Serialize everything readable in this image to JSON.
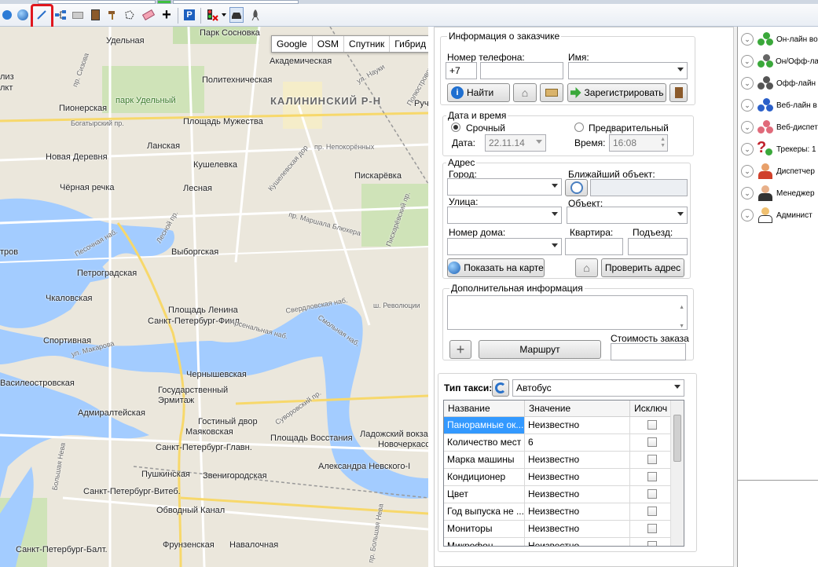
{
  "map": {
    "type_buttons": [
      "Google",
      "OSM",
      "Спутник",
      "Гибрид"
    ],
    "labels": [
      "Парк Сосновка",
      "Удельная",
      "Академическая",
      "Политехническая",
      "Пионерская",
      "парк Удельный",
      "КАЛИНИНСКИЙ Р-Н",
      "Площадь Мужества",
      "Новая Деревня",
      "Ланская",
      "Кушелевка",
      "Пискарёвка",
      "Чёрная речка",
      "Лесная",
      "Выборгская",
      "Петроградская",
      "Чкаловская",
      "Площадь Ленина",
      "Санкт-Петербург-Финл.",
      "Спортивная",
      "Чернышевская",
      "Государственный Эрмитаж",
      "Адмиралтейская",
      "Гостиный двор",
      "Маяковская",
      "Площадь Восстания",
      "Санкт-Петербург-Главн.",
      "Ладожский вокзал",
      "Новочеркасская",
      "Пушкинская",
      "Звенигородская",
      "Александра Невского-I",
      "Санкт-Петербург-Витеб.",
      "Обводный Канал",
      "Санкт-Петербург-Балт.",
      "Фрунзенская",
      "Навалочная",
      "Василеостровская",
      "тров",
      "лиз",
      "лкт",
      "Руч"
    ],
    "streets": [
      "пр. Сизова",
      "Богатырский пр.",
      "ул. Науки",
      "пр. Непокорённых",
      "Кушелевская дор",
      "пр. Маршала Блюхера",
      "Лесной пр.",
      "Пискарёвский пр.",
      "Песочная наб.",
      "Свердловская наб.",
      "ш. Революции",
      "Арсенальная наб.",
      "Смольная наб.",
      "ул. Макарова",
      "Суворовский пр.",
      "Большая Нева",
      "Полюстровский пр.",
      "пр. Большая Нева"
    ]
  },
  "order": {
    "customer": {
      "title": "Информация о заказчике",
      "phone_label": "Номер телефона:",
      "phone_value": "+7",
      "name_label": "Имя:",
      "find_button": "Найти",
      "register_button": "Зарегистрировать"
    },
    "datetime": {
      "title": "Дата и время",
      "urgent_label": "Срочный",
      "preliminary_label": "Предварительный",
      "date_label": "Дата:",
      "date_value": "22.11.14",
      "time_label": "Время:",
      "time_value": "16:08"
    },
    "address": {
      "title": "Адрес",
      "city_label": "Город:",
      "nearest_label": "Ближайший объект:",
      "street_label": "Улица:",
      "object_label": "Объект:",
      "house_label": "Номер дома:",
      "apartment_label": "Квартира:",
      "entrance_label": "Подъезд:",
      "show_map_button": "Показать на карте",
      "check_button": "Проверить адрес"
    },
    "extra": {
      "title": "Дополнительная информация",
      "route_button": "Маршрут",
      "cost_label": "Стоимость заказа",
      "add_symbol": "+"
    },
    "taxi": {
      "type_label": "Тип такси:",
      "type_value": "Автобус",
      "columns": [
        "Название",
        "Значение",
        "Исключ"
      ],
      "rows": [
        {
          "name": "Панорамные ок...",
          "value": "Неизвестно"
        },
        {
          "name": "Количество мест",
          "value": "6"
        },
        {
          "name": "Марка машины",
          "value": "Неизвестно"
        },
        {
          "name": "Кондиционер",
          "value": "Неизвестно"
        },
        {
          "name": "Цвет",
          "value": "Неизвестно"
        },
        {
          "name": "Год выпуска не ...",
          "value": "Неизвестно"
        },
        {
          "name": "Мониторы",
          "value": "Неизвестно"
        },
        {
          "name": "Микрофон",
          "value": "Неизвестно"
        }
      ]
    }
  },
  "users": [
    {
      "label": "Он-лайн во",
      "icon": "online-users-icon"
    },
    {
      "label": "Он/Офф-ла",
      "icon": "onoff-users-icon"
    },
    {
      "label": "Офф-лайн",
      "icon": "offline-users-icon"
    },
    {
      "label": "Веб-лайн в",
      "icon": "web-online-icon"
    },
    {
      "label": "Веб-диспет",
      "icon": "web-dispatcher-icon"
    },
    {
      "label": "Трекеры: 1",
      "icon": "trackers-icon"
    },
    {
      "label": "Диспетчер",
      "icon": "dispatcher-icon"
    },
    {
      "label": "Менеджер",
      "icon": "manager-icon"
    },
    {
      "label": "Админист",
      "icon": "admin-icon"
    }
  ]
}
